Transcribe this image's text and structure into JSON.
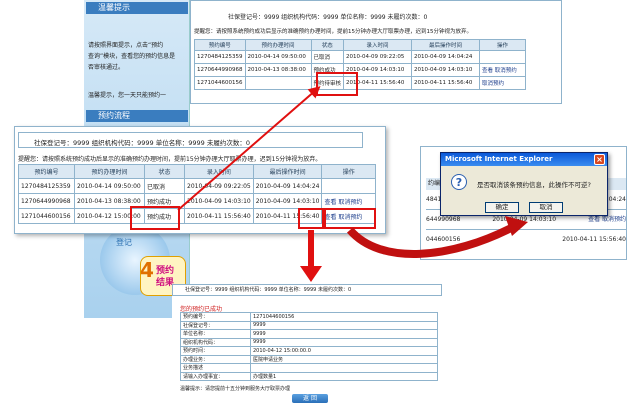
{
  "sidebar": {
    "tips_title": "温馨提示",
    "tips_lines": [
      "请按照界面提示，点击“预约",
      "查询”模块，查看您的预约信息是",
      "否审核通过。"
    ],
    "thanks": "温馨提示，您一天只能预约一",
    "flow_title": "预约流程",
    "step_label": "登记",
    "badge_number": "4",
    "badge_line1": "预约",
    "badge_line2": "结果"
  },
  "panel_top": {
    "info": "社保登记号：9999 组织机构代码：9999 单位名称：9999 未履约次数：0",
    "notice": "提醒您：请按照系统预约成功后显示的准确预约办理时间，提前15分钟办理大厅取票办理，迟到15分钟视为放弃。",
    "headers": [
      "预约编号",
      "预约办理时间",
      "状态",
      "录入时间",
      "最后操作时间",
      "操作"
    ],
    "rows": [
      {
        "id": "1270484125359",
        "time": "2010-04-14 09:50:00",
        "status": "已取消",
        "entry": "2010-04-09 09:22:05",
        "last": "2010-04-09 14:04:24",
        "action1": "",
        "action2": ""
      },
      {
        "id": "1270644990968",
        "time": "2010-04-13 08:38:00",
        "status": "预约成功",
        "entry": "2010-04-09 14:03:10",
        "last": "2010-04-09 14:03:10",
        "action1": "查看",
        "action2": "取消预约"
      },
      {
        "id": "1271044600156",
        "time": "",
        "status": "预约待审核",
        "entry": "2010-04-11 15:56:40",
        "last": "2010-04-11 15:56:40",
        "action1": "",
        "action2": "取消预约"
      }
    ]
  },
  "panel_mid": {
    "info": "社保登记号：9999 组织机构代码：9999 单位名称：9999 未履约次数：0",
    "notice": "提醒您：请按照系统预约成功后显示的准确预约办理时间，提前15分钟办理大厅取票办理，迟到15分钟视为放弃。",
    "headers": [
      "预约编号",
      "预约办理时间",
      "状态",
      "录入时间",
      "最后操作时间",
      "操作"
    ],
    "rows": [
      {
        "id": "1270484125359",
        "time": "2010-04-14 09:50:00",
        "status": "已取消",
        "entry": "2010-04-09 09:22:05",
        "last": "2010-04-09 14:04:24",
        "action1": "",
        "action2": ""
      },
      {
        "id": "1270644990968",
        "time": "2010-04-13 08:38:00",
        "status": "预约成功",
        "entry": "2010-04-09 14:03:10",
        "last": "2010-04-09 14:03:10",
        "action1": "查看",
        "action2": "取消预约"
      },
      {
        "id": "1271044600156",
        "time": "2010-04-12 15:00:00",
        "status": "预约成功",
        "entry": "2010-04-11 15:56:40",
        "last": "2010-04-11 15:56:40",
        "action1": "查看",
        "action2": "取消预约"
      }
    ]
  },
  "dialog": {
    "title": "Microsoft Internet Explorer",
    "message": "是否取消该条预约信息，此操作不可逆?",
    "ok": "确定",
    "cancel": "取消",
    "bg_header": "约编号",
    "bg_rows": [
      {
        "id": "484125",
        "time": "2010-04-09 14:04:24"
      },
      {
        "id": "644990968",
        "time": "2010-04-09 14:03:10",
        "action": "查看 取消预约"
      },
      {
        "id": "044600156",
        "time": "2010-04-11 15:56:40"
      }
    ]
  },
  "detail": {
    "info": "社保登记号：9999 组织机构代码：9999 单位名称：9999 未履约次数：0",
    "title": "您的预约已成功",
    "rows": [
      {
        "label": "预约编号：",
        "value": "1271044600156"
      },
      {
        "label": "社保登记号：",
        "value": "9999"
      },
      {
        "label": "单位名称：",
        "value": "9999"
      },
      {
        "label": "组织机构代码：",
        "value": "9999"
      },
      {
        "label": "预约时间：",
        "value": "2010-04-12 15:00:00.0"
      },
      {
        "label": "办理业务：",
        "value": "医院申请业务"
      },
      {
        "label": "业务描述",
        "value": ""
      },
      {
        "label": "请输入办理事宜：",
        "value": "办理数量1"
      }
    ],
    "footer": "温馨提示：请您提前十五分钟到服务大厅取票办理",
    "back_button": "返 回"
  },
  "colors": {
    "highlight": "#e01010",
    "header_bg": "#dbe8f3",
    "accent": "#2a7fc1"
  }
}
